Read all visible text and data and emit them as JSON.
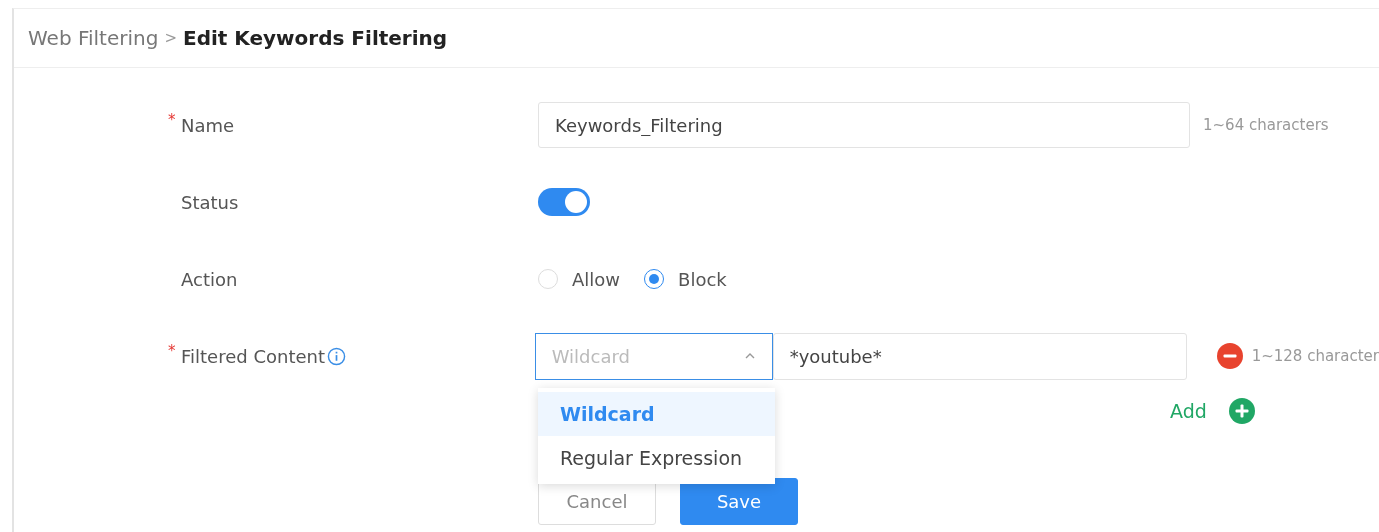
{
  "breadcrumb": {
    "parent": "Web Filtering",
    "separator": ">",
    "current": "Edit Keywords Filtering"
  },
  "form": {
    "name": {
      "label": "Name",
      "required_mark": "*",
      "value": "Keywords_Filtering",
      "hint": "1~64 characters"
    },
    "status": {
      "label": "Status",
      "on": true
    },
    "action": {
      "label": "Action",
      "options": [
        {
          "label": "Allow",
          "selected": false
        },
        {
          "label": "Block",
          "selected": true
        }
      ]
    },
    "filtered_content": {
      "label": "Filtered Content",
      "required_mark": "*",
      "type_select": {
        "value": "Wildcard",
        "expanded": true
      },
      "value": "*youtube*",
      "hint": "1~128 character",
      "add_label": "Add",
      "dropdown_options": [
        {
          "label": "Wildcard",
          "selected": true
        },
        {
          "label": "Regular Expression",
          "selected": false
        }
      ]
    }
  },
  "buttons": [
    {
      "label": "Cancel",
      "kind": "secondary"
    },
    {
      "label": "Save",
      "kind": "primary"
    }
  ]
}
